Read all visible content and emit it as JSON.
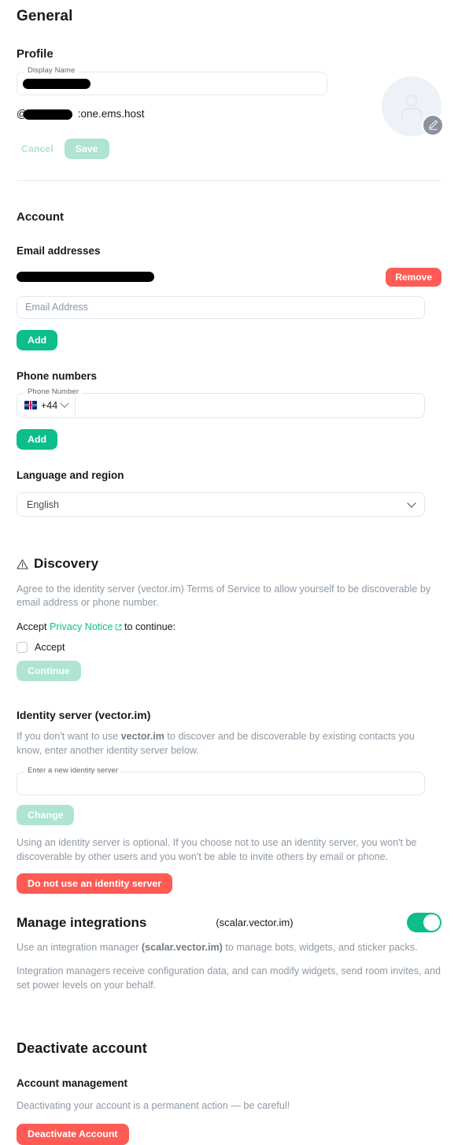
{
  "page": {
    "title": "General"
  },
  "profile": {
    "heading": "Profile",
    "display_name_label": "Display Name",
    "display_name_value": "",
    "mxid_prefix": "@",
    "mxid_suffix": ":one.ems.host",
    "cancel_label": "Cancel",
    "save_label": "Save",
    "avatar_icon": "person-icon",
    "avatar_edit_icon": "pencil-icon",
    "avatar_bg": "#eef1f8",
    "avatar_edit_bg": "#8c929d"
  },
  "account": {
    "heading": "Account",
    "email": {
      "heading": "Email addresses",
      "remove_label": "Remove",
      "input_placeholder": "Email Address",
      "input_value": "",
      "add_label": "Add"
    },
    "phone": {
      "heading": "Phone numbers",
      "field_label": "Phone Number",
      "country_flag": "gb-flag-icon",
      "country_code": "+44",
      "input_value": "",
      "add_label": "Add"
    },
    "language": {
      "heading": "Language and region",
      "selected": "English"
    }
  },
  "discovery": {
    "icon": "warning-triangle-icon",
    "heading": "Discovery",
    "description": "Agree to the identity server (vector.im) Terms of Service to allow yourself to be discoverable by email address or phone number.",
    "accept_prefix": "Accept",
    "privacy_link": "Privacy Notice",
    "accept_suffix": "to continue:",
    "checkbox_label": "Accept",
    "checkbox_checked": false,
    "continue_label": "Continue"
  },
  "identity_server": {
    "heading": "Identity server (vector.im)",
    "description_pre": "If you don't want to use ",
    "description_bold": "vector.im",
    "description_post": " to discover and be discoverable by existing contacts you know, enter another identity server below.",
    "input_label": "Enter a new identity server",
    "input_value": "",
    "change_label": "Change",
    "note": "Using an identity server is optional. If you choose not to use an identity server, you won't be discoverable by other users and you won't be able to invite others by email or phone.",
    "disable_label": "Do not use an identity server"
  },
  "integrations": {
    "heading": "Manage integrations",
    "server": "(scalar.vector.im)",
    "toggle_on": true,
    "desc1_pre": "Use an integration manager ",
    "desc1_bold": "(scalar.vector.im)",
    "desc1_post": " to manage bots, widgets, and sticker packs.",
    "desc2": "Integration managers receive configuration data, and can modify widgets, send room invites, and set power levels on your behalf."
  },
  "deactivate": {
    "heading": "Deactivate account",
    "subheading": "Account management",
    "warning": "Deactivating your account is a permanent action — be careful!",
    "button_label": "Deactivate Account"
  },
  "colors": {
    "accent_green": "#0dbd8b",
    "accent_green_disabled": "#aee4d1",
    "danger_red": "#ff5b55",
    "text_primary": "#17191c",
    "text_muted": "#8e99a4",
    "border": "#e3e8f0"
  }
}
